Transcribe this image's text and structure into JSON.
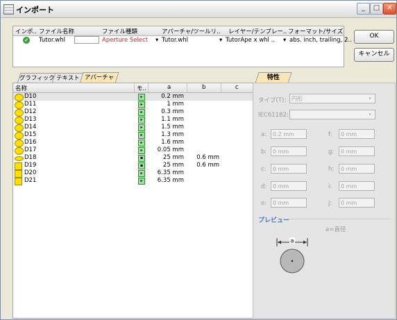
{
  "window": {
    "title": "インポート"
  },
  "titlebar_buttons": {
    "minimize": "_",
    "maximize": "□",
    "close": "✕"
  },
  "import_grid": {
    "headers": [
      "インポ..",
      "ファイル名称",
      "ファイル種類",
      "アパーチャ/ツールリ..",
      "レイヤー/テンプレー..",
      "フォーマット/サイズ"
    ],
    "row": {
      "file_name": "Tutor.whl",
      "file_type": "Aperture Select",
      "aperture": "Tutor.whl",
      "layer": "TutorApe x whl ..",
      "format": "abs. inch, trailing, 2.."
    }
  },
  "buttons": {
    "ok": "OK",
    "cancel": "キャンセル"
  },
  "tabs": [
    "グラフィック",
    "テキスト",
    "アパーチャ"
  ],
  "aperture_list": {
    "headers": [
      "名称",
      "モ..",
      "a",
      "b",
      "c"
    ],
    "rows": [
      {
        "name": "D10",
        "shape": "circle",
        "a": "0.2 mm",
        "b": ""
      },
      {
        "name": "D11",
        "shape": "circle",
        "a": "1 mm",
        "b": ""
      },
      {
        "name": "D12",
        "shape": "circle",
        "a": "0.3 mm",
        "b": ""
      },
      {
        "name": "D13",
        "shape": "circle",
        "a": "1.1 mm",
        "b": ""
      },
      {
        "name": "D14",
        "shape": "circle",
        "a": "1.5 mm",
        "b": ""
      },
      {
        "name": "D15",
        "shape": "circle",
        "a": "1.3 mm",
        "b": ""
      },
      {
        "name": "D16",
        "shape": "circle",
        "a": "1.6 mm",
        "b": ""
      },
      {
        "name": "D17",
        "shape": "circle",
        "a": "0.05 mm",
        "b": ""
      },
      {
        "name": "D18",
        "shape": "oval",
        "a": "25 mm",
        "b": "0.6 mm"
      },
      {
        "name": "D19",
        "shape": "square",
        "a": "25 mm",
        "b": "0.6 mm"
      },
      {
        "name": "D20",
        "shape": "square",
        "a": "6.35 mm",
        "b": ""
      },
      {
        "name": "D21",
        "shape": "square",
        "a": "6.35 mm",
        "b": ""
      }
    ]
  },
  "properties": {
    "tab": "特性",
    "type_label": "タイプ(T):",
    "type_value": "円形",
    "iec_label": "IEC61182:",
    "fields": [
      {
        "label": "a:",
        "value": "0.2 mm"
      },
      {
        "label": "f:",
        "value": "0 mm"
      },
      {
        "label": "b:",
        "value": "0 mm"
      },
      {
        "label": "g:",
        "value": "0 mm"
      },
      {
        "label": "c:",
        "value": "0 mm"
      },
      {
        "label": "h:",
        "value": "0 mm"
      },
      {
        "label": "d:",
        "value": "0 mm"
      },
      {
        "label": "i:",
        "value": "0 mm"
      },
      {
        "label": "e:",
        "value": "0 mm"
      },
      {
        "label": "j:",
        "value": "0 mm"
      }
    ],
    "preview_title": "プレビュー",
    "preview_caption": "a=直径",
    "dim_label": "a"
  }
}
